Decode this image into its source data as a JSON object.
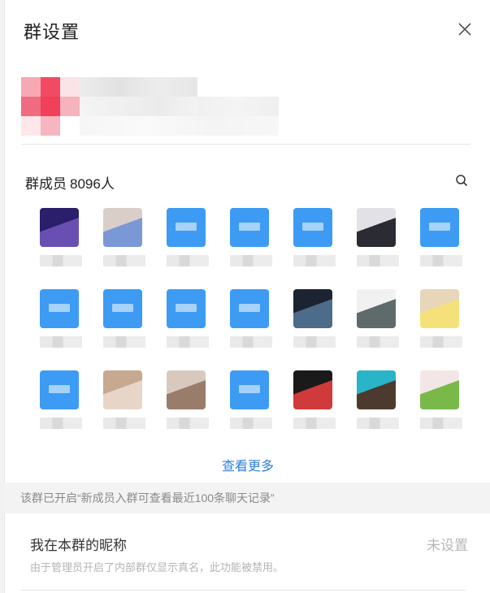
{
  "title": "群设置",
  "members": {
    "label": "群成员",
    "count": "8096人",
    "more_label": "查看更多",
    "items": [
      {
        "kind": "photo",
        "c1": "#2b1f6b",
        "c2": "#6a4fb3",
        "name": ""
      },
      {
        "kind": "photo",
        "c1": "#d9cfc8",
        "c2": "#7a98d6",
        "name": ""
      },
      {
        "kind": "default",
        "name": ""
      },
      {
        "kind": "default",
        "name": ""
      },
      {
        "kind": "default",
        "name": ""
      },
      {
        "kind": "photo",
        "c1": "#e2e2e6",
        "c2": "#2b2b33",
        "name": ""
      },
      {
        "kind": "default",
        "name": ""
      },
      {
        "kind": "default",
        "name": ""
      },
      {
        "kind": "default",
        "name": ""
      },
      {
        "kind": "default",
        "name": ""
      },
      {
        "kind": "default",
        "name": ""
      },
      {
        "kind": "photo",
        "c1": "#1b2430",
        "c2": "#4c6c8a",
        "name": ""
      },
      {
        "kind": "photo",
        "c1": "#f1f1f1",
        "c2": "#5f6b6a",
        "name": ""
      },
      {
        "kind": "photo",
        "c1": "#e8d6b8",
        "c2": "#f4e17a",
        "name": ""
      },
      {
        "kind": "default",
        "name": ""
      },
      {
        "kind": "photo",
        "c1": "#c7a98f",
        "c2": "#e7d6c8",
        "name": ""
      },
      {
        "kind": "photo",
        "c1": "#d8c9bf",
        "c2": "#9a7c6b",
        "name": ""
      },
      {
        "kind": "default",
        "name": ""
      },
      {
        "kind": "photo",
        "c1": "#1a1a1a",
        "c2": "#d03a3a",
        "name": ""
      },
      {
        "kind": "photo",
        "c1": "#2ab4c8",
        "c2": "#4d3a2e",
        "name": ""
      },
      {
        "kind": "photo",
        "c1": "#f3e6e6",
        "c2": "#78b94a",
        "name": ""
      }
    ]
  },
  "notice": "该群已开启“新成员入群可查看最近100条聊天记录”",
  "nickname": {
    "label": "我在本群的昵称",
    "value": "未设置",
    "note": "由于管理员开启了内部群仅显示真名，此功能被禁用。"
  },
  "colors": {
    "accent": "#2f7fdb",
    "default_avatar": "#3d9bf4",
    "notice_bg": "#f3f3f3",
    "group_avatar": [
      "#f07a8c",
      "#f24a63",
      "#fbe4e8",
      "#e95c71",
      "#f36a80",
      "#fbd0d7"
    ]
  }
}
